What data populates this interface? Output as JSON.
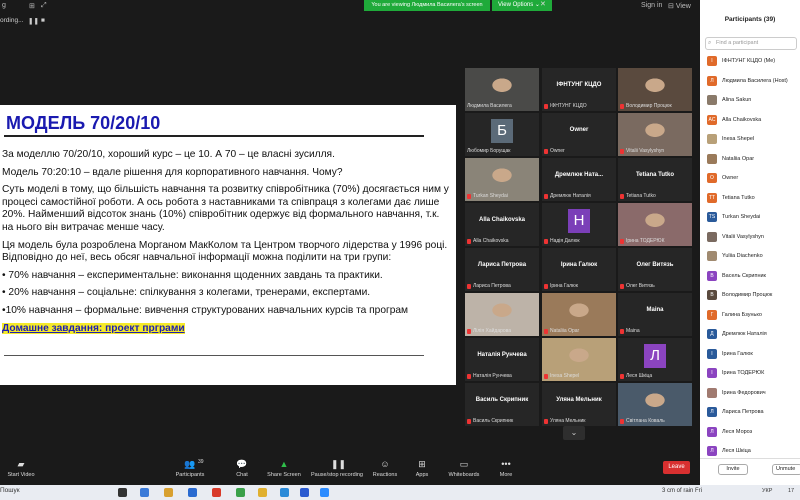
{
  "top_bar": {
    "left_text": "g",
    "viewing_banner": "You are viewing Людмила Василега's screen",
    "view_options": "View Options",
    "sign_in": "Sign in",
    "view": "View"
  },
  "recording_bar": {
    "text": "ording..."
  },
  "slide": {
    "title": "МОДЕЛЬ 70/20/10",
    "p1": "За моделлю 70/20/10, хороший курс – це 10. А 70 – це власні зусилля.",
    "p2": "Модель 70:20:10 – вдале рішення для корпоративного навчання. Чому?",
    "p3": "Суть моделі в тому, що більшість навчання та розвитку співробітника (70%) досягається ним у процесі самостійної роботи. А ось робота з наставниками та співпраця з колегами дає лише 20%. Найменший відсоток знань (10%) співробітник одержує від формального навчання, т.к. на нього він витрачає менше часу.",
    "p4": "Ця модель була розроблена Морганом МакКолом та Центром творчого лідерства у 1996 році. Відповідно до неї, весь обсяг навчальної інформації можна поділити на три групи:",
    "b1": "• 70% навчання – експериментальне: виконання щоденних завдань та практики.",
    "b2": "• 20% навчання – соціальне: спілкування з колегами, тренерами, експертами.",
    "b3": "•10% навчання – формальне: вивчення структурованих навчальних курсів та програм",
    "homework": "Домашне завдання: проект прграми"
  },
  "tiles": [
    {
      "name": "Людмила Василега",
      "center": "",
      "kind": "photo",
      "color": "#4a4a48",
      "mic": false,
      "active": true
    },
    {
      "name": "ІФНТУНГ КЦДО",
      "center": "ІФНТУНГ КЦДО",
      "kind": "text",
      "mic": true
    },
    {
      "name": "Володимир Процюк",
      "center": "",
      "kind": "photo",
      "color": "#5a4a3e",
      "mic": true
    },
    {
      "name": "Любомир Борущак",
      "center": "",
      "kind": "letter",
      "letter": "Б",
      "color": "#5b6a78",
      "mic": false
    },
    {
      "name": "Owner",
      "center": "Owner",
      "kind": "text",
      "mic": true
    },
    {
      "name": "Vitalii Vasylyshyn",
      "center": "",
      "kind": "photo",
      "color": "#7a6a60",
      "mic": true
    },
    {
      "name": "Turkan Sheydai",
      "center": "",
      "kind": "photo",
      "color": "#8a8478",
      "mic": true
    },
    {
      "name": "Дремлюк Наталія",
      "center": "Дремлюк Ната...",
      "kind": "text",
      "mic": true
    },
    {
      "name": "Tetiana Tutko",
      "center": "Tetiana Tutko",
      "kind": "text",
      "mic": true
    },
    {
      "name": "Alla Chaikovska",
      "center": "Alla Chaikovska",
      "kind": "text",
      "mic": true
    },
    {
      "name": "Надія Далюк",
      "center": "",
      "kind": "letter",
      "letter": "Н",
      "color": "#7b3fb8",
      "mic": true
    },
    {
      "name": "Ірина ТОДЕРЮК",
      "center": "",
      "kind": "photo",
      "color": "#8a6a6a",
      "mic": true
    },
    {
      "name": "Лариса Петрова",
      "center": "Лариса Петрова",
      "kind": "text",
      "mic": true
    },
    {
      "name": "Ірина Галюк",
      "center": "Ірина Галюк",
      "kind": "text",
      "mic": true
    },
    {
      "name": "Олег Витязь",
      "center": "Олег Витязь",
      "kind": "text",
      "mic": true
    },
    {
      "name": "Лілія Хайдарова",
      "center": "",
      "kind": "photo",
      "color": "#bdb3a8",
      "mic": true
    },
    {
      "name": "Nataliia Opar",
      "center": "",
      "kind": "photo",
      "color": "#9a7a5a",
      "mic": true
    },
    {
      "name": "Maina",
      "center": "Maina",
      "kind": "text",
      "mic": true
    },
    {
      "name": "Наталія Рунчева",
      "center": "Наталія Рунчева",
      "kind": "text",
      "mic": true
    },
    {
      "name": "Inesa Shepel",
      "center": "",
      "kind": "photo",
      "color": "#b8a078",
      "mic": true
    },
    {
      "name": "Леся Шкіца",
      "center": "",
      "kind": "letter",
      "letter": "Л",
      "color": "#8b44c0",
      "mic": true
    },
    {
      "name": "Василь Скрипник",
      "center": "Василь Скрипник",
      "kind": "text",
      "mic": true
    },
    {
      "name": "Уляна Мельник",
      "center": "Уляна Мельник",
      "kind": "text",
      "mic": true
    },
    {
      "name": "Світлана Коваль",
      "center": "",
      "kind": "photo",
      "color": "#4a5a6a",
      "mic": true
    }
  ],
  "grid_nav": "⌄",
  "toolbar": {
    "start_video": "Start Video",
    "participants": "Participants",
    "participants_count": "39",
    "chat": "Chat",
    "share_screen": "Share Screen",
    "record": "Pause/stop recording",
    "reactions": "Reactions",
    "apps": "Apps",
    "whiteboards": "Whiteboards",
    "more": "More",
    "leave": "Leave"
  },
  "panel": {
    "title": "Participants (39)",
    "search_placeholder": "Find a participant",
    "participants": [
      {
        "initial": "І",
        "name": "ІФНТУНГ КЦДО (Me)",
        "color": "#e06a2a"
      },
      {
        "initial": "Л",
        "name": "Людмила Василега (Host)",
        "color": "#e06a2a"
      },
      {
        "initial": "",
        "name": "Alina Sakun",
        "color": "#8a7a6a"
      },
      {
        "initial": "AC",
        "name": "Alla Chaikovska",
        "color": "#e06a2a"
      },
      {
        "initial": "",
        "name": "Inesa Shepel",
        "color": "#b8a078"
      },
      {
        "initial": "",
        "name": "Nataliia Opar",
        "color": "#9a7a5a"
      },
      {
        "initial": "O",
        "name": "Owner",
        "color": "#e06a2a"
      },
      {
        "initial": "TT",
        "name": "Tetiana Tutko",
        "color": "#e06a2a"
      },
      {
        "initial": "TS",
        "name": "Turkan Sheydai",
        "color": "#2a5a9a"
      },
      {
        "initial": "",
        "name": "Vitalii Vasylyshyn",
        "color": "#7a6a60"
      },
      {
        "initial": "",
        "name": "Yuliia Diachenko",
        "color": "#a08a70"
      },
      {
        "initial": "В",
        "name": "Васель Скрипник",
        "color": "#8b44c0"
      },
      {
        "initial": "В",
        "name": "Володимир Процюк",
        "color": "#5a4a3e"
      },
      {
        "initial": "Г",
        "name": "Галина Бзунько",
        "color": "#e06a2a"
      },
      {
        "initial": "Д",
        "name": "Дремлюк Наталія",
        "color": "#2a5a9a"
      },
      {
        "initial": "І",
        "name": "Ірина Галюк",
        "color": "#2a5a9a"
      },
      {
        "initial": "І",
        "name": "Ірина ТОДЕРЮК",
        "color": "#8b44c0"
      },
      {
        "initial": "",
        "name": "Ірина Федорович",
        "color": "#a07a70"
      },
      {
        "initial": "Л",
        "name": "Лариса Петрова",
        "color": "#2a5a9a"
      },
      {
        "initial": "Л",
        "name": "Леся Мороз",
        "color": "#8b44c0"
      },
      {
        "initial": "Л",
        "name": "Леся Шкіца",
        "color": "#8b44c0"
      }
    ],
    "invite": "Invite",
    "unmute": "Unmute"
  },
  "taskbar": {
    "search": "Пошук",
    "weather": "3 cm of rain Fri",
    "lang": "УКР",
    "time": "17"
  }
}
